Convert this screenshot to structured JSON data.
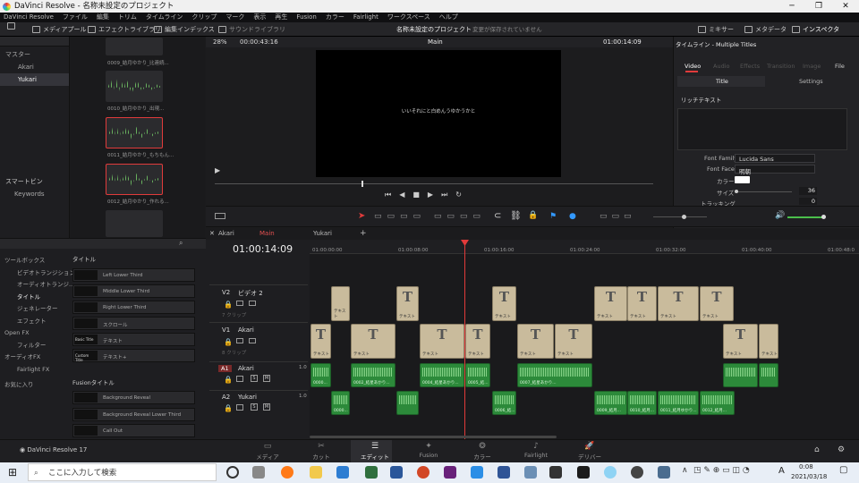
{
  "window": {
    "title": "DaVinci Resolve - 名称未設定のプロジェクト"
  },
  "menu": [
    "DaVinci Resolve",
    "ファイル",
    "編集",
    "トリム",
    "タイムライン",
    "クリップ",
    "マーク",
    "表示",
    "再生",
    "Fusion",
    "カラー",
    "Fairlight",
    "ワークスペース",
    "ヘルプ"
  ],
  "toolbar": {
    "media_pool": "メディアプール",
    "effects_library": "エフェクトライブラリ",
    "edit_index": "編集インデックス",
    "sound_library": "サウンドライブラリ",
    "project_name": "名称未設定のプロジェクト",
    "unsaved": "変更が保存されていません",
    "mixer": "ミキサー",
    "metadata": "メタデータ",
    "inspector": "インスペクタ"
  },
  "viewer": {
    "zoom": "28%",
    "timecode_left": "00:00:43:16",
    "timeline_name": "Main",
    "timecode_right": "01:00:14:09",
    "screen_text": "いいそれにと白めんうゆかうかと"
  },
  "left_tree": {
    "master": "マスター",
    "items": [
      "Akari",
      "Yukari"
    ],
    "smart_bins": "スマートビン",
    "keywords": "Keywords"
  },
  "clips": [
    "0009_結月ゆかり_比連続...",
    "0010_結月ゆかり_出現...",
    "0011_結月ゆかり_もちもん...",
    "0012_結月ゆかり_作れる..."
  ],
  "inspector": {
    "header": "タイムライン - Multiple Titles",
    "tabs": [
      "Video",
      "Audio",
      "Effects",
      "Transition",
      "Image",
      "File"
    ],
    "subtabs": [
      "Title",
      "Settings"
    ],
    "rich_text": "リッチテキスト",
    "font_family_label": "Font Family",
    "font_family": "Lucida Sans",
    "font_face_label": "Font Face",
    "font_face": "明朝",
    "color_label": "カラー",
    "size_label": "サイズ",
    "size_value": "36",
    "tracking_label": "トラッキング",
    "tracking_value": "0"
  },
  "effects": {
    "toolbox": "ツールボックス",
    "items": [
      "ビデオトランジション",
      "オーディオトランジ...",
      "タイトル",
      "ジェネレーター",
      "エフェクト"
    ],
    "open_fx": "Open FX",
    "filters": "フィルター",
    "audio_fx": "オーディオFX",
    "fairlight_fx": "Fairlight FX",
    "favorites": "お気に入り",
    "titles_header": "タイトル",
    "titles": [
      "Left Lower Third",
      "Middle Lower Third",
      "Right Lower Third",
      "スクロール",
      "テキスト",
      "テキスト+"
    ],
    "title_thumbs": [
      "",
      "",
      "",
      "",
      "Basic Title",
      "Custom Title"
    ],
    "fusion_header": "Fusionタイトル",
    "fusion_titles": [
      "Background Reveal",
      "Background Reveal Lower Third",
      "Call Out"
    ]
  },
  "timeline": {
    "tabs": [
      "Akari",
      "Main",
      "Yukari"
    ],
    "timecode": "01:00:14:09",
    "ruler": [
      "01:00:00:00",
      "01:00:08:00",
      "01:00:16:00",
      "01:00:24:00",
      "01:00:32:00",
      "01:00:40:00",
      "01:00:48:0"
    ],
    "tracks": [
      {
        "id": "V2",
        "name": "ビデオ 2",
        "sub": "7 クリップ"
      },
      {
        "id": "V1",
        "name": "Akari",
        "sub": "8 クリップ"
      },
      {
        "id": "A1",
        "name": "Akari",
        "vol": "1.0"
      },
      {
        "id": "A2",
        "name": "Yukari",
        "vol": "1.0"
      }
    ],
    "clip_text": "テキスト",
    "audio_labels": [
      "0000...",
      "0002_結星あかり...",
      "0004_結星あかり...",
      "0005_結...",
      "0007_結星あかり...",
      "0000...",
      "0006_結...",
      "0009_結月...",
      "0010_結月...",
      "0011_結月ゆかり...",
      "0012_結月..."
    ]
  },
  "pages": [
    "メディア",
    "カット",
    "エディット",
    "Fusion",
    "カラー",
    "Fairlight",
    "デリバー"
  ],
  "app_footer": "DaVinci Resolve 17",
  "taskbar": {
    "search": "ここに入力して検索",
    "time": "0:08",
    "date": "2021/03/18",
    "ime": "A"
  }
}
